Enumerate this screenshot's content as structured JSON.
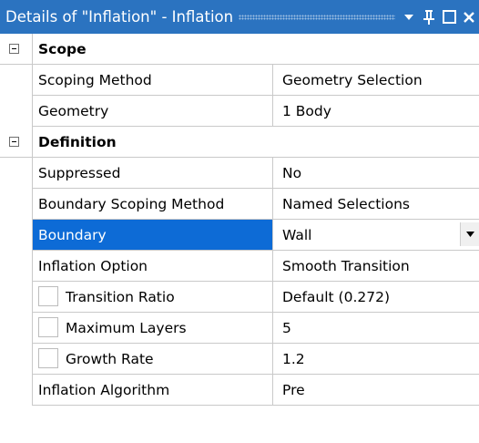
{
  "titlebar": {
    "title": "Details of \"Inflation\" - Inflation",
    "icons": [
      "dropdown-arrow-icon",
      "pin-icon",
      "maximize-icon",
      "close-icon"
    ]
  },
  "groups": {
    "scope": {
      "label": "Scope",
      "rows": {
        "scoping_method": {
          "name": "Scoping Method",
          "value": "Geometry Selection"
        },
        "geometry": {
          "name": "Geometry",
          "value": "1 Body"
        }
      }
    },
    "definition": {
      "label": "Definition",
      "rows": {
        "suppressed": {
          "name": "Suppressed",
          "value": "No"
        },
        "boundary_scoping_method": {
          "name": "Boundary Scoping Method",
          "value": "Named Selections"
        },
        "boundary": {
          "name": "Boundary",
          "value": "Wall",
          "selected": true
        },
        "inflation_option": {
          "name": "Inflation Option",
          "value": "Smooth Transition"
        },
        "transition_ratio": {
          "name": "Transition Ratio",
          "value": "Default (0.272)",
          "checked": false
        },
        "maximum_layers": {
          "name": "Maximum Layers",
          "value": "5",
          "checked": false
        },
        "growth_rate": {
          "name": "Growth Rate",
          "value": "1.2",
          "checked": false
        },
        "inflation_algorithm": {
          "name": "Inflation Algorithm",
          "value": "Pre"
        }
      }
    }
  },
  "colors": {
    "titlebar_bg": "#2b73c0",
    "selection_bg": "#0d6bd6",
    "grid_line": "#c9c9c9"
  }
}
